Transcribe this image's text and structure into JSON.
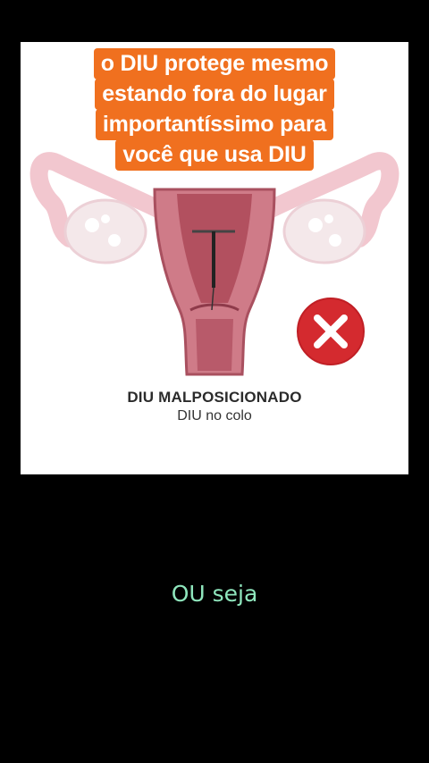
{
  "banner": {
    "lines": [
      "o DIU protege mesmo",
      "estando fora do lugar",
      "importantíssimo para",
      "você que usa DIU"
    ]
  },
  "diagram": {
    "title": "DIU MALPOSICIONADO",
    "subtitle": "DIU no colo",
    "status_icon": "x-mark-icon"
  },
  "caption": "OU seja",
  "colors": {
    "banner_bg": "#f0701f",
    "x_icon": "#d42a2f",
    "caption_text": "#8fe6bd",
    "uterus": "#c56b7a"
  }
}
